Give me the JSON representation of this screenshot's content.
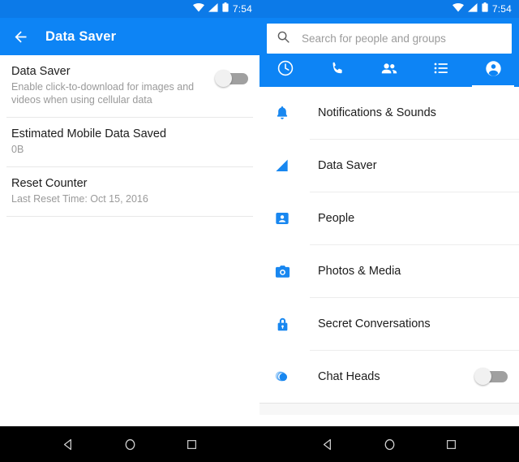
{
  "status_bar": {
    "time": "7:54",
    "icons": [
      "wifi-icon",
      "cellular-signal-icon",
      "battery-icon"
    ]
  },
  "colors": {
    "status_bar_blue": "#0c7ae8",
    "toolbar_blue": "#0d84f5",
    "accent_blue": "#1b8cf7",
    "icon_blue": "#1887f0",
    "divider": "#e8e8e8",
    "text_primary": "#1c1c1c",
    "text_secondary": "#9a9a9a",
    "nav_bar": "#000000"
  },
  "left_pane": {
    "toolbar": {
      "back_icon": "arrow-left-icon",
      "title": "Data Saver"
    },
    "rows": [
      {
        "title": "Data Saver",
        "subtitle": "Enable click-to-download for images and videos when using cellular data",
        "has_toggle": true,
        "toggle_on": false
      },
      {
        "title": "Estimated Mobile Data Saved",
        "subtitle": "0B",
        "has_toggle": false,
        "toggle_on": false
      },
      {
        "title": "Reset Counter",
        "subtitle": "Last Reset Time: Oct 15, 2016",
        "has_toggle": false,
        "toggle_on": false
      }
    ]
  },
  "right_pane": {
    "search": {
      "icon": "search-icon",
      "placeholder": "Search for people and groups",
      "value": ""
    },
    "tabs": [
      {
        "name": "recent",
        "icon": "clock-icon",
        "active": false
      },
      {
        "name": "calls",
        "icon": "phone-icon",
        "active": false
      },
      {
        "name": "groups",
        "icon": "people-icon",
        "active": false
      },
      {
        "name": "lists",
        "icon": "list-icon",
        "active": false
      },
      {
        "name": "profile",
        "icon": "person-circle-icon",
        "active": true
      }
    ],
    "menu_items": [
      {
        "label": "Notifications & Sounds",
        "icon": "bell-icon",
        "has_toggle": false,
        "toggle_on": false
      },
      {
        "label": "Data Saver",
        "icon": "signal-triangle-icon",
        "has_toggle": false,
        "toggle_on": false
      },
      {
        "label": "People",
        "icon": "contact-card-icon",
        "has_toggle": false,
        "toggle_on": false
      },
      {
        "label": "Photos & Media",
        "icon": "camera-icon",
        "has_toggle": false,
        "toggle_on": false
      },
      {
        "label": "Secret Conversations",
        "icon": "lock-icon",
        "has_toggle": false,
        "toggle_on": false
      },
      {
        "label": "Chat Heads",
        "icon": "chat-heads-icon",
        "has_toggle": true,
        "toggle_on": false
      }
    ]
  },
  "nav_bar": {
    "buttons": [
      {
        "name": "back",
        "icon": "triangle-back-icon"
      },
      {
        "name": "home",
        "icon": "circle-home-icon"
      },
      {
        "name": "recents",
        "icon": "square-recents-icon"
      }
    ]
  }
}
